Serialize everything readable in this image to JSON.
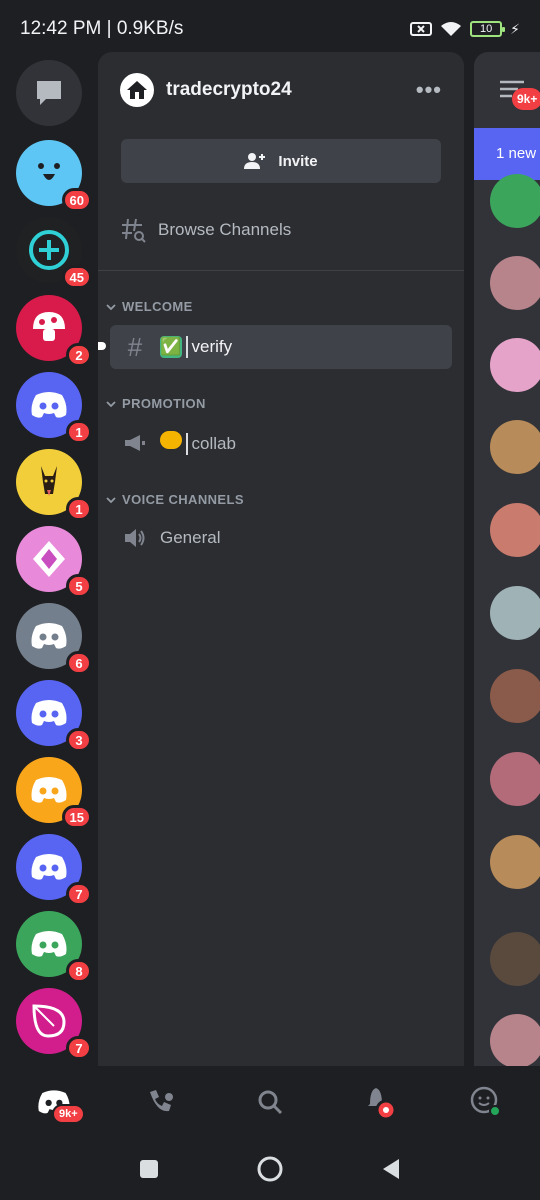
{
  "status_bar": {
    "time_speed": "12:42 PM | 0.9KB/s",
    "battery": "10"
  },
  "server": {
    "name": "tradecrypto24"
  },
  "actions": {
    "invite_label": "Invite",
    "browse_label": "Browse Channels"
  },
  "categories": [
    {
      "name": "WELCOME"
    },
    {
      "name": "PROMOTION"
    },
    {
      "name": "VOICE CHANNELS"
    }
  ],
  "channels": [
    {
      "name": "verify",
      "emoji": "✅",
      "type": "text",
      "active": true
    },
    {
      "name": "collab",
      "emoji": "🤝",
      "type": "announcement",
      "active": false
    },
    {
      "name": "General",
      "type": "voice",
      "active": false
    }
  ],
  "servers": [
    {
      "badge": "60",
      "color": "#5dc6f4"
    },
    {
      "badge": "45",
      "color": "#1f2123"
    },
    {
      "badge": "2",
      "color": "#d81b4a"
    },
    {
      "badge": "1",
      "color": "#5865f2"
    },
    {
      "badge": "1",
      "color": "#f2cf3a"
    },
    {
      "badge": "5",
      "color": "#e889d9"
    },
    {
      "badge": "6",
      "color": "#747f8d"
    },
    {
      "badge": "3",
      "color": "#5865f2"
    },
    {
      "badge": "15",
      "color": "#faa61a"
    },
    {
      "badge": "7",
      "color": "#5865f2"
    },
    {
      "badge": "8",
      "color": "#3ba55c"
    },
    {
      "badge": "7",
      "color": "#d11e8c"
    }
  ],
  "peek": {
    "badge": "9k+",
    "new_label": "1 new"
  },
  "bottom_nav": {
    "home_badge": "9k+"
  }
}
